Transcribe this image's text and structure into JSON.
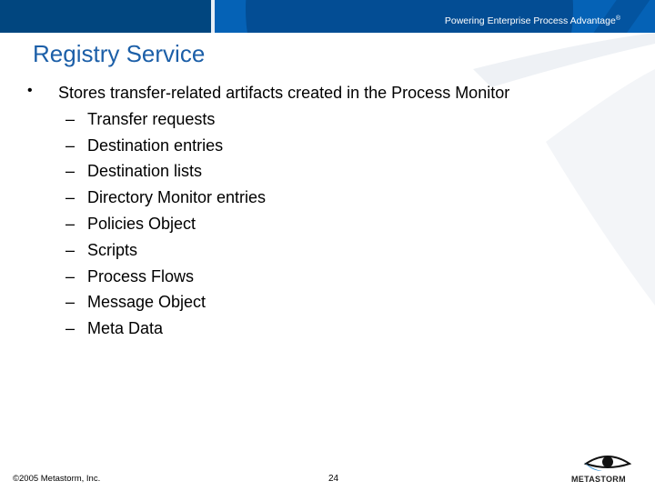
{
  "header": {
    "tagline": "Powering Enterprise Process Advantage",
    "tagline_mark": "®",
    "colors": {
      "band_dark": "#01467f",
      "band_light": "#0562b6"
    }
  },
  "slide": {
    "title": "Registry Service",
    "title_color": "#1c5fa8",
    "bullet": {
      "marker": "•",
      "text": "Stores transfer-related artifacts created in the Process Monitor",
      "sub_marker": "–",
      "items": [
        "Transfer requests",
        "Destination entries",
        "Destination lists",
        "Directory Monitor entries",
        "Policies Object",
        "Scripts",
        "Process Flows",
        "Message Object",
        "Meta Data"
      ]
    }
  },
  "footer": {
    "copyright": "©2005 Metastorm, Inc.",
    "page_number": "24",
    "logo_text": "METASTORM",
    "logo_icon": "eye-icon"
  }
}
